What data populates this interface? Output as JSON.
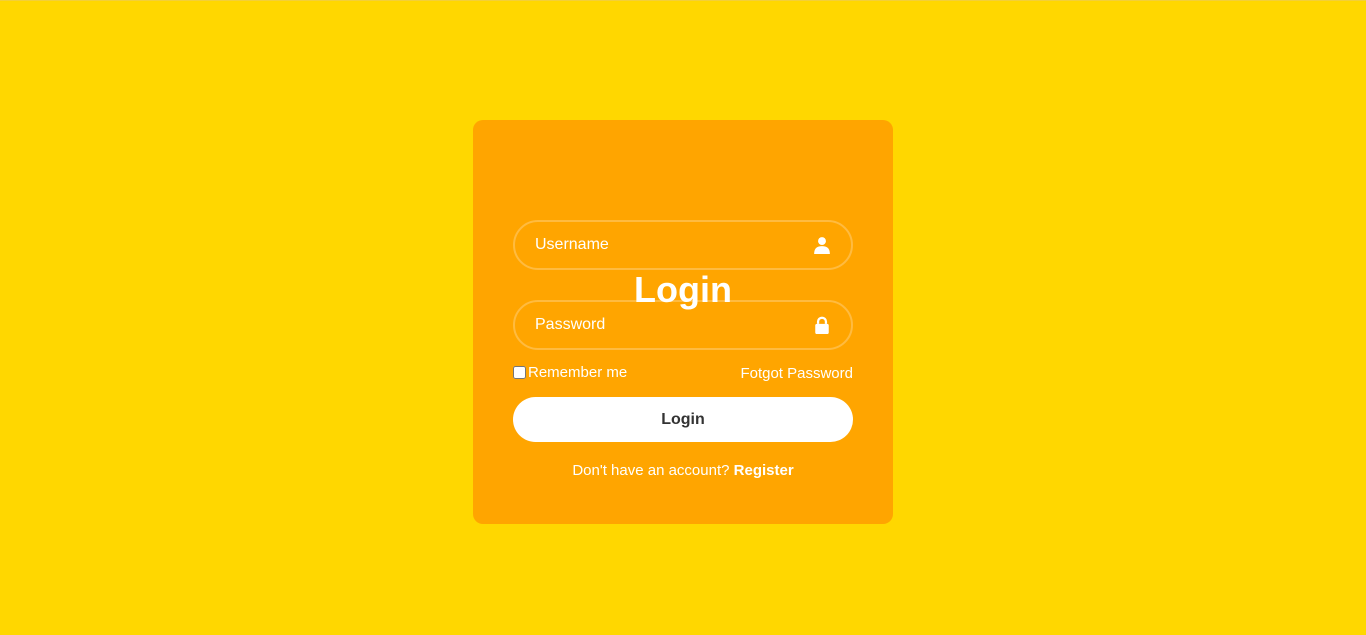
{
  "page": {
    "background_color": "#FFD700"
  },
  "card": {
    "background_color": "#FFA500",
    "title": "Login"
  },
  "form": {
    "username": {
      "placeholder": "Username",
      "value": "",
      "icon": "user-icon"
    },
    "password": {
      "placeholder": "Password",
      "value": "",
      "icon": "lock-icon"
    },
    "remember_label": "Remember me",
    "remember_checked": false,
    "forgot_label": "Fotgot Password",
    "submit_label": "Login",
    "register_prompt": "Don't have an account?",
    "register_label": "Register"
  }
}
